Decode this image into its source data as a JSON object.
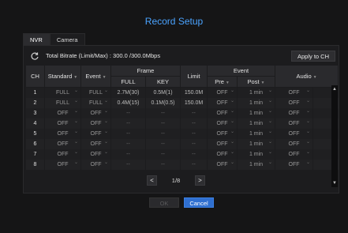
{
  "title": "Record Setup",
  "tabs": [
    {
      "label": "NVR",
      "active": true
    },
    {
      "label": "Camera",
      "active": false
    }
  ],
  "bitrate_text": "Total Bitrate (Limit/Max) : 300.0 /300.0Mbps",
  "apply_label": "Apply to CH",
  "headers": {
    "ch": "CH",
    "standard": "Standard",
    "event": "Event",
    "frame": "Frame",
    "full": "FULL",
    "key": "KEY",
    "limit": "Limit",
    "event_group": "Event",
    "pre": "Pre",
    "post": "Post",
    "audio": "Audio"
  },
  "rows": [
    {
      "ch": "1",
      "standard": "FULL",
      "event": "FULL",
      "full": "2.7M(30)",
      "key": "0.5M(1)",
      "limit": "150.0M",
      "pre": "OFF",
      "post": "1 min",
      "audio": "OFF"
    },
    {
      "ch": "2",
      "standard": "FULL",
      "event": "FULL",
      "full": "0.4M(15)",
      "key": "0.1M(0.5)",
      "limit": "150.0M",
      "pre": "OFF",
      "post": "1 min",
      "audio": "OFF"
    },
    {
      "ch": "3",
      "standard": "OFF",
      "event": "OFF",
      "full": "--",
      "key": "--",
      "limit": "--",
      "pre": "OFF",
      "post": "1 min",
      "audio": "OFF"
    },
    {
      "ch": "4",
      "standard": "OFF",
      "event": "OFF",
      "full": "--",
      "key": "--",
      "limit": "--",
      "pre": "OFF",
      "post": "1 min",
      "audio": "OFF"
    },
    {
      "ch": "5",
      "standard": "OFF",
      "event": "OFF",
      "full": "--",
      "key": "--",
      "limit": "--",
      "pre": "OFF",
      "post": "1 min",
      "audio": "OFF"
    },
    {
      "ch": "6",
      "standard": "OFF",
      "event": "OFF",
      "full": "--",
      "key": "--",
      "limit": "--",
      "pre": "OFF",
      "post": "1 min",
      "audio": "OFF"
    },
    {
      "ch": "7",
      "standard": "OFF",
      "event": "OFF",
      "full": "--",
      "key": "--",
      "limit": "--",
      "pre": "OFF",
      "post": "1 min",
      "audio": "OFF"
    },
    {
      "ch": "8",
      "standard": "OFF",
      "event": "OFF",
      "full": "--",
      "key": "--",
      "limit": "--",
      "pre": "OFF",
      "post": "1 min",
      "audio": "OFF"
    }
  ],
  "pager": {
    "prev": "<",
    "page": "1/8",
    "next": ">"
  },
  "ok_label": "OK",
  "cancel_label": "Cancel",
  "colors": {
    "accent": "#4aa3ff",
    "primary_button": "#2f6fd0"
  }
}
